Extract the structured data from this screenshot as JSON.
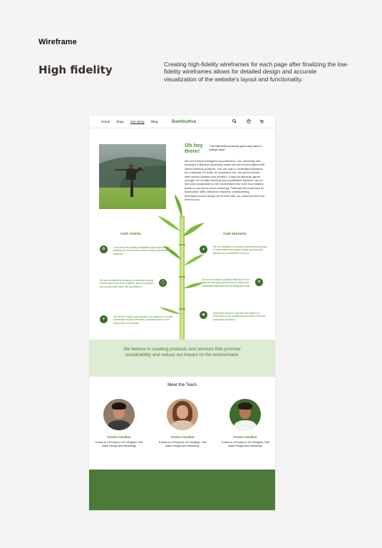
{
  "header": {
    "section_label": "Wireframe",
    "title": "High fidelity",
    "description": "Creating high-fidelity wireframes for each page after finalizing the low-fidelity wireframes allows for detailed design and accurate visualization of the website's layout and functionality."
  },
  "site": {
    "nav": {
      "links": [
        "Home",
        "Shop",
        "Our Story",
        "Blog"
      ],
      "active": "Our Story",
      "brand": "Bambuttva",
      "icons": [
        "search-icon",
        "user-icon",
        "cart-icon"
      ]
    },
    "hero": {
      "greeting": "Oh hey there!",
      "quote": "\"The Bambuttva journey goes way back in college days\"",
      "story": "We are Product Designers by profession. Our university had arranged a Bamboo workshop where we had to innovate/create varied Bamboo products. The aim was to understand Bamboo as a material, it's traits, it's properties etc. We got to interact with various artisans and creators. It was an absolute 'game changer' for us after learning how sustainable Bamboo can be. Not only sustainable for the environment but even how healthy Bamboo can be for one's wellbeing. That was the head start for Bambuttva. With extensive research, brainstorming, development and design we're here with our outcomes that suit best for you."
    },
    "vision": {
      "title": "OUR VISION",
      "items": [
        "To become the leading sustainable brand that sets the standard for ethical and environmentally responsible practices.",
        "We are committed to creating a world where people and the planet can thrive together, and our products and services will reflect this commitment.",
        "We strive to inspire and empower our customers to make sustainable choices that have a positive impact on the environment and society."
      ]
    },
    "mission": {
      "title": "OUR MISSION",
      "items": [
        "We are dedicated to reducing environmental impact of deforestation and plastic usage by promoting Bamboo as a sustainable resource.",
        "Our aim is to make a positive difference in the world by offering products that are made from sustainable materials and are designed to last.",
        "Bambuttva strives to educate and inspire our customers to live sustainably and make conscious purchasing decisions."
      ]
    },
    "banner": "We believe in creating products and services that promote sustainability and reduce our impact on the environment.",
    "team": {
      "title": "Meet the Team",
      "members": [
        {
          "name": "Trusha Vasulkar",
          "bio": "Trusha is a Product & UX Designer. She leads Design and Marketing."
        },
        {
          "name": "Trusha Vasulkar",
          "bio": "Trusha is a Product & UX Designer. She leads Design and Marketing."
        },
        {
          "name": "Trusha Vasulkar",
          "bio": "Trusha is a Product & UX Designer. She leads Design and Marketing."
        }
      ]
    },
    "colors": {
      "brand_green": "#4f8a2e",
      "banner_bg": "#deebd5",
      "footer_bg": "#4d7a3a"
    }
  }
}
